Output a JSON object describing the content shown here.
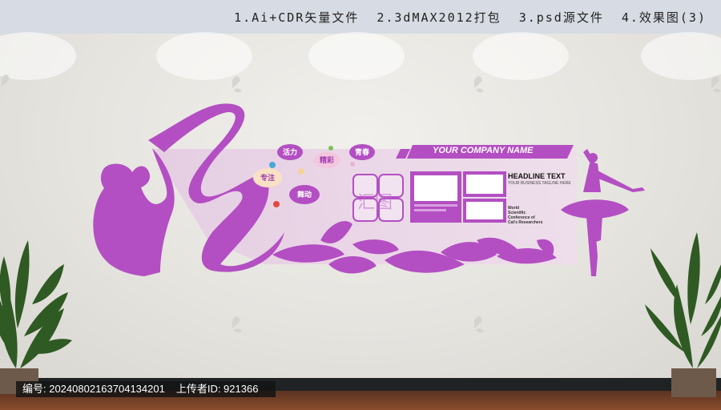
{
  "top_bar": {
    "items": [
      "1.Ai+CDR矢量文件",
      "2.3dMAX2012打包",
      "3.psd源文件",
      "4.效果图(3)"
    ]
  },
  "wall_panel": {
    "company_name": "YOUR COMPANY NAME",
    "headline": "HEADLINE TEXT",
    "subline": "YOUR BUSINESS TAGLINE HERE",
    "org_lines": [
      "World",
      "Scientific",
      "Conference of",
      "Cat's Researchers"
    ],
    "bubbles": [
      "活力",
      "精彩",
      "青春",
      "专注",
      "舞动"
    ]
  },
  "bottom_bar": {
    "id_label": "编号: 20240802163704134201",
    "uploader_label": "上传者ID: 921366"
  },
  "colors": {
    "accent_purple": "#b34fc2",
    "panel_pink": "#e8d2e6",
    "top_bar": "#d7dbe3"
  }
}
